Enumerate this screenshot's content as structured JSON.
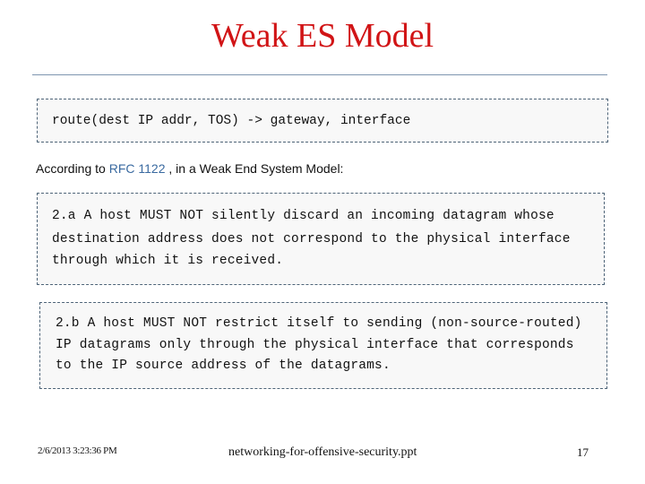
{
  "slide": {
    "title": "Weak ES Model",
    "route_signature": "route(dest IP addr, TOS) -> gateway, interface",
    "intro": {
      "prefix": "According to ",
      "link_text": "RFC 1122",
      "suffix": " , in a Weak End System Model:"
    },
    "rule_a": [
      "2.a A host MUST NOT silently discard an incoming datagram whose",
      "destination address does not correspond to the physical interface",
      "through which it is received."
    ],
    "rule_b": [
      "2.b A host MUST NOT restrict itself to sending (non-source-routed)",
      "IP datagrams only through the physical interface that corresponds",
      "to the IP source address of the datagrams."
    ]
  },
  "footer": {
    "date": "2/6/2013 3:23:36 PM",
    "filename": "networking-for-offensive-security.ppt",
    "page_number": "17"
  },
  "colors": {
    "title": "#d11416",
    "link": "#3a6aa0",
    "divider": "#7e96b0",
    "box_border": "#4e6478",
    "box_background": "#f8f8f8"
  }
}
